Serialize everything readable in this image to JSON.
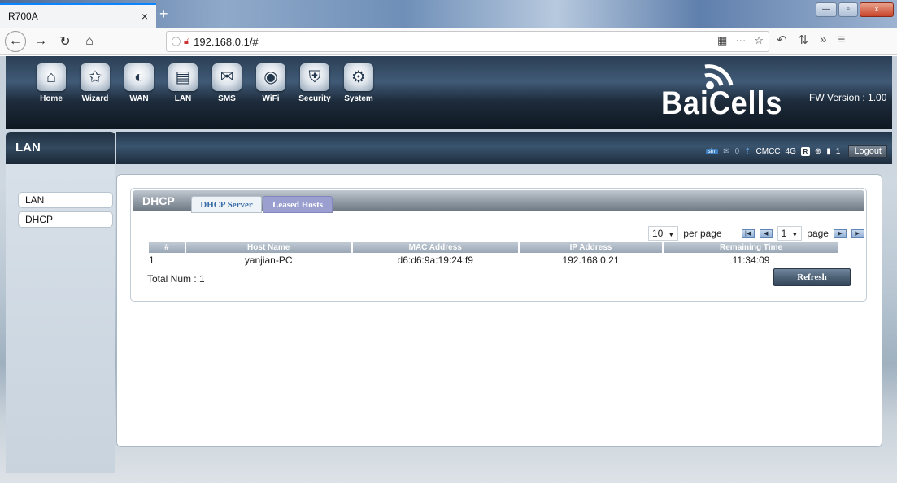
{
  "browser": {
    "tab_title": "R700A",
    "tab_close": "×",
    "new_tab": "+",
    "url": "192.168.0.1/#",
    "window_controls": {
      "minimize": "—",
      "maximize": "▫",
      "close": "x"
    },
    "nav_icons": [
      "back-icon",
      "forward-icon",
      "reload-icon",
      "home-icon"
    ],
    "url_icons": [
      "qr-code-icon",
      "more-icon",
      "bookmark-star-icon"
    ],
    "toolbar_icons": [
      "undo-icon",
      "extension-icon",
      "overflow-icon",
      "menu-icon"
    ]
  },
  "header": {
    "menu": [
      {
        "label": "Home",
        "icon": "home-icon",
        "glyph": "⌂"
      },
      {
        "label": "Wizard",
        "icon": "wizard-icon",
        "glyph": "✩"
      },
      {
        "label": "WAN",
        "icon": "wan-icon",
        "glyph": "◐"
      },
      {
        "label": "LAN",
        "icon": "lan-icon",
        "glyph": "▤"
      },
      {
        "label": "SMS",
        "icon": "sms-icon",
        "glyph": "✉"
      },
      {
        "label": "WiFi",
        "icon": "wifi-icon",
        "glyph": "◉"
      },
      {
        "label": "Security",
        "icon": "security-icon",
        "glyph": "⛨"
      },
      {
        "label": "System",
        "icon": "system-icon",
        "glyph": "⚙"
      }
    ],
    "logo_text": "BaiCells",
    "fw_version": "FW Version : 1.00"
  },
  "sidebar": {
    "title": "LAN",
    "items": [
      {
        "label": "LAN"
      },
      {
        "label": "DHCP"
      }
    ]
  },
  "status": {
    "sim_label": "sim",
    "sms_count": "0",
    "operator": "CMCC",
    "network": "4G",
    "device_count": "1",
    "logout_label": "Logout"
  },
  "dhcp": {
    "title": "DHCP",
    "tabs": [
      "DHCP Server",
      "Leased Hosts"
    ],
    "active_tab": "Leased Hosts",
    "per_page_value": "10",
    "per_page_label": "per page",
    "page_value": "1",
    "page_label": "page",
    "columns": [
      "#",
      "Host Name",
      "MAC Address",
      "IP Address",
      "Remaining Time"
    ],
    "rows": [
      {
        "idx": "1",
        "host": "yanjian-PC",
        "mac": "d6:d6:9a:19:24:f9",
        "ip": "192.168.0.21",
        "remaining": "11:34:09"
      }
    ],
    "total": "Total Num : 1",
    "refresh_label": "Refresh"
  },
  "colors": {
    "header_dark": "#1d2b3b",
    "tab_active": "#9a9fcf",
    "tab_link": "#3a6ea8"
  }
}
